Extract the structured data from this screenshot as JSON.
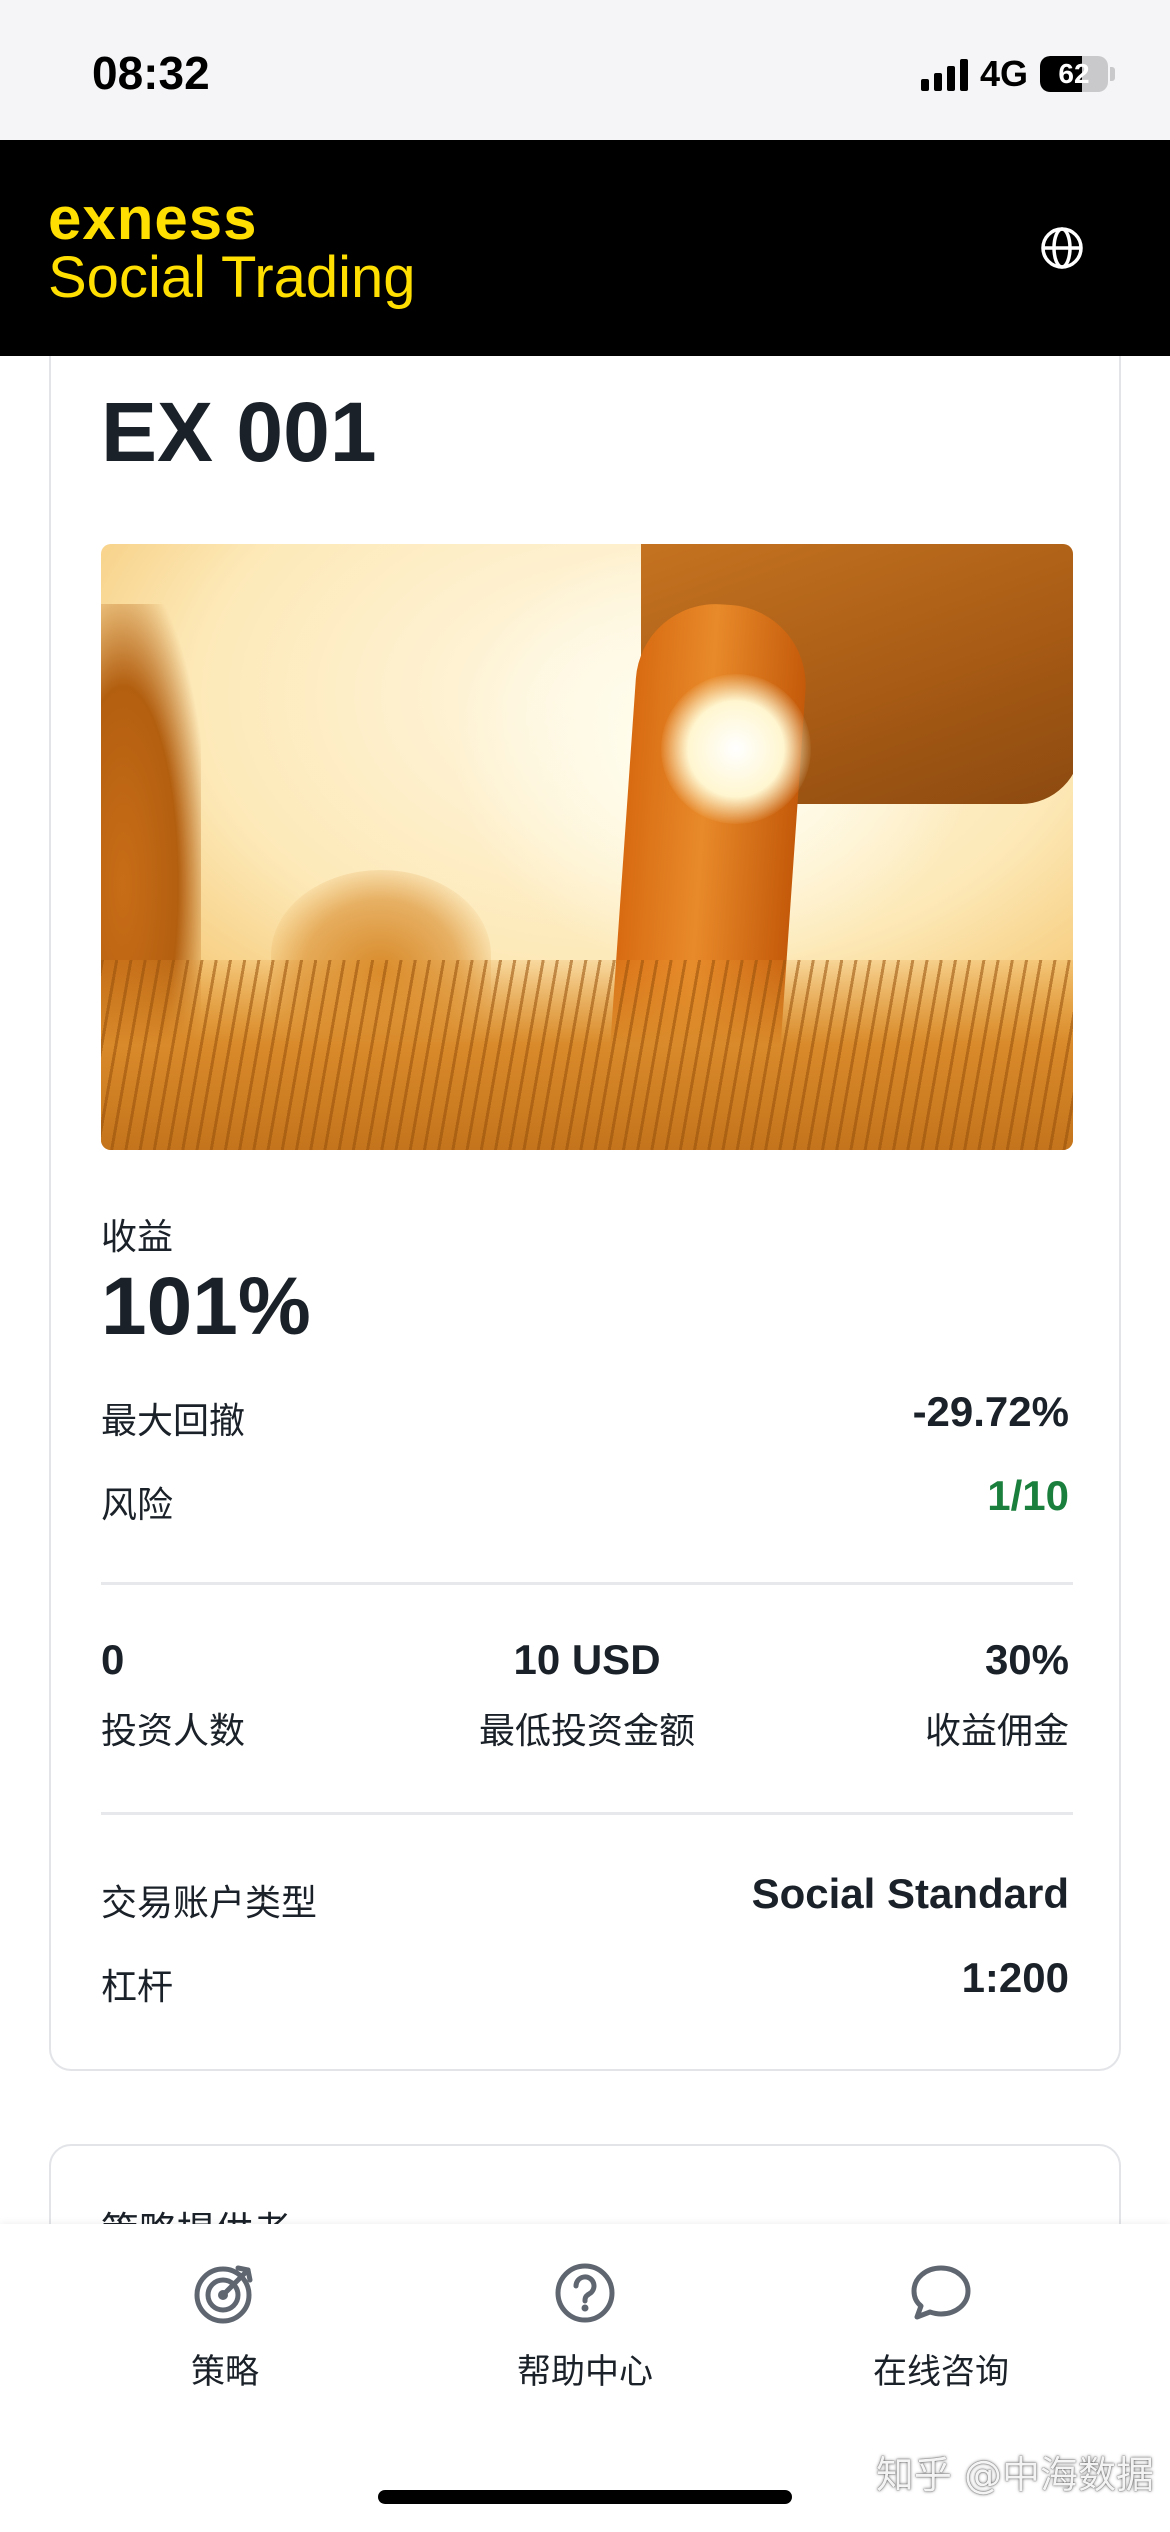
{
  "status_bar": {
    "time": "08:32",
    "network": "4G",
    "battery_level": "62",
    "battery_fraction": 0.62
  },
  "header": {
    "logo_line1": "exness",
    "logo_line2": "Social Trading",
    "brand_color": "#ffde02",
    "language_icon": "globe-icon"
  },
  "strategy": {
    "name": "EX 001",
    "return_label": "收益",
    "return_value": "101%",
    "max_drawdown_label": "最大回撤",
    "max_drawdown_value": "-29.72%",
    "risk_label": "风险",
    "risk_value": "1/10",
    "risk_color": "#1a7f3c",
    "stats": [
      {
        "value": "0",
        "label": "投资人数"
      },
      {
        "value": "10 USD",
        "label": "最低投资金额"
      },
      {
        "value": "30%",
        "label": "收益佣金"
      }
    ],
    "account_type_label": "交易账户类型",
    "account_type_value": "Social Standard",
    "leverage_label": "杠杆",
    "leverage_value": "1:200"
  },
  "provider_card": {
    "title": "策略提供者"
  },
  "bottom_nav": [
    {
      "label": "策略",
      "icon": "target-icon"
    },
    {
      "label": "帮助中心",
      "icon": "help-circle-icon"
    },
    {
      "label": "在线咨询",
      "icon": "chat-bubble-icon"
    }
  ],
  "watermark": "知乎 @中海数据"
}
